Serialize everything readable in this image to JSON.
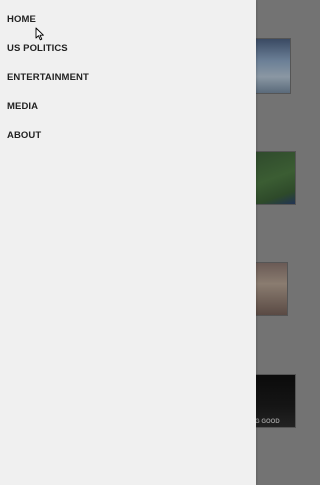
{
  "nav": {
    "items": [
      {
        "label": "HOME"
      },
      {
        "label": "US POLITICS"
      },
      {
        "label": "ENTERTAINMENT"
      },
      {
        "label": "MEDIA"
      },
      {
        "label": "ABOUT"
      }
    ]
  },
  "background": {
    "thumb_4_caption": "G GOOD"
  },
  "colors": {
    "drawer_bg": "#f0f0f0",
    "overlay": "#737373",
    "text": "#222222"
  },
  "icons": {
    "cursor": "mouse-pointer-icon"
  }
}
